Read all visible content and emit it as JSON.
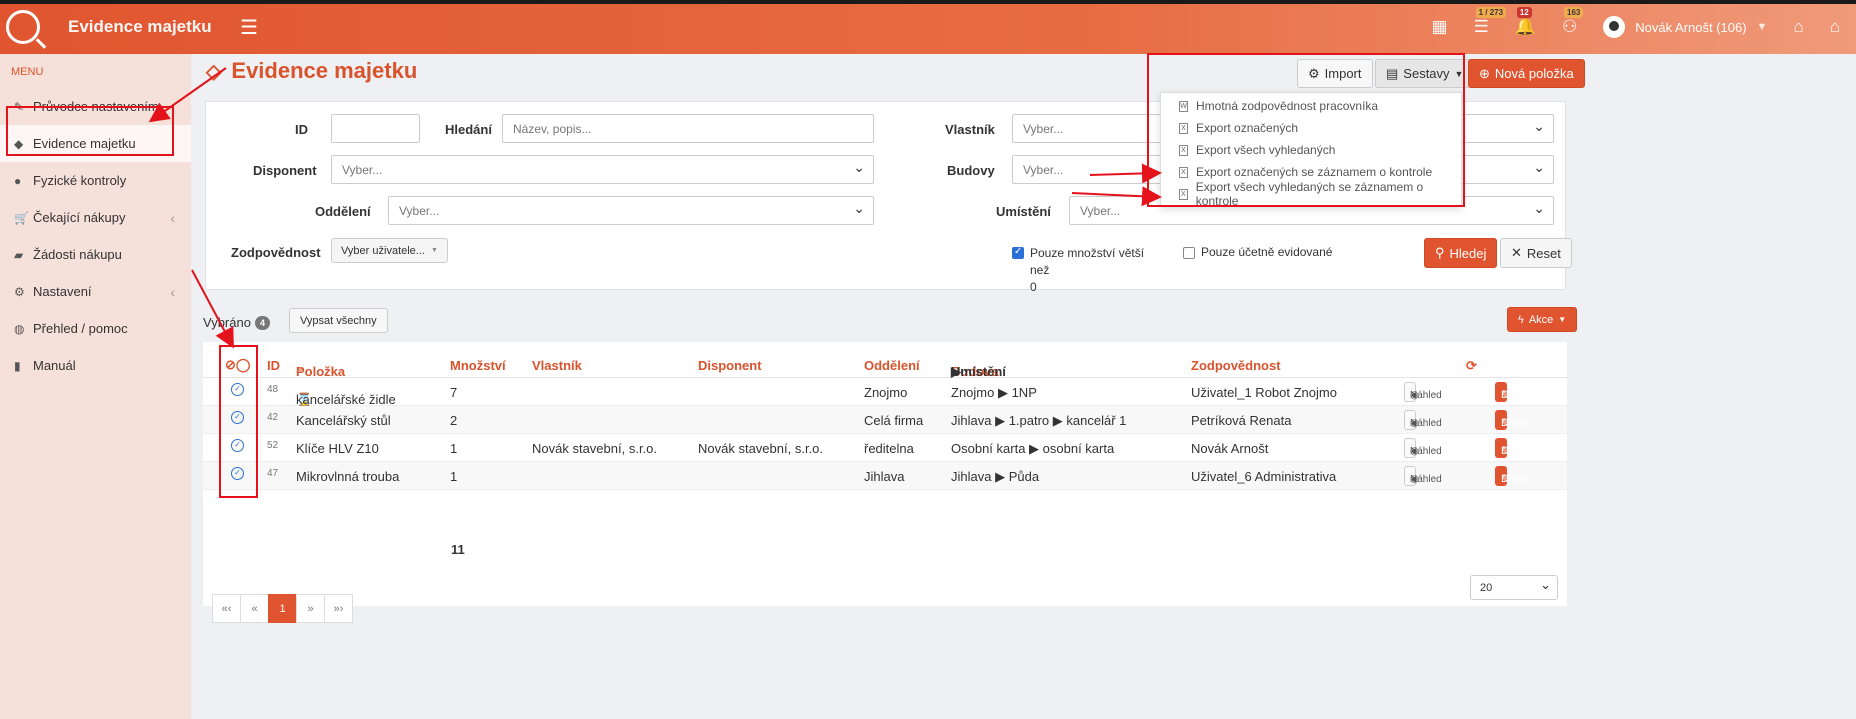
{
  "app": {
    "title": "Evidence majetku"
  },
  "topbar": {
    "badges": {
      "tasks": "1 / 273",
      "bell": "12",
      "group": "163"
    },
    "user": "Novák Arnošt (106)"
  },
  "sidebar": {
    "menu_label": "MENU",
    "items": [
      {
        "label": "Průvodce nastavením",
        "icon": "pencil-icon"
      },
      {
        "label": "Evidence majetku",
        "icon": "diamond-icon"
      },
      {
        "label": "Fyzické kontroly",
        "icon": "check-circle-icon"
      },
      {
        "label": "Čekající nákupy",
        "icon": "cart-icon"
      },
      {
        "label": "Žádosti nákupu",
        "icon": "edit-icon"
      },
      {
        "label": "Nastavení",
        "icon": "gears-icon"
      },
      {
        "label": "Přehled / pomoc",
        "icon": "globe-icon"
      },
      {
        "label": "Manuál",
        "icon": "book-icon"
      }
    ]
  },
  "page": {
    "title": "Evidence majetku",
    "import_label": "Import",
    "sestavy_label": "Sestavy",
    "nova_label": "Nová položka"
  },
  "dropdown": {
    "items": [
      "Hmotná zodpovědnost pracovníka",
      "Export označených",
      "Export všech vyhledaných",
      "Export označených se záznamem o kontrole",
      "Export všech vyhledaných se záznamem o kontrole"
    ]
  },
  "filters": {
    "id_label": "ID",
    "search_label": "Hledání",
    "search_placeholder": "Název, popis...",
    "owner_label": "Vlastník",
    "owner_value": "Vyber...",
    "disponent_label": "Disponent",
    "disponent_value": "Vyber...",
    "buildings_label": "Budovy",
    "buildings_value": "Vyber...",
    "dept_label": "Oddělení",
    "dept_value": "Vyber...",
    "location_label": "Umístění",
    "location_value": "Vyber...",
    "resp_label": "Zodpovědnost",
    "resp_value": "Vyber uživatele...",
    "qty_check": "Pouze množství větší než",
    "qty_value": "0",
    "acct_check": "Pouze účetně evidované",
    "search_btn": "Hledej",
    "reset_btn": "Reset"
  },
  "results": {
    "selected_label": "Vybráno",
    "selected_count": "4",
    "list_all_btn": "Vypsat všechny",
    "actions_btn": "Akce",
    "columns": {
      "id": "ID",
      "item": "Položka",
      "qty": "Množství",
      "owner": "Vlastník",
      "disponent": "Disponent",
      "dept": "Oddělení",
      "building": "Budova",
      "arrow": "▶",
      "location": "Umístění",
      "resp": "Zodpovědnost"
    },
    "rows": [
      {
        "id": "48",
        "item": "kancelářské židle",
        "qty": "7",
        "owner": "",
        "disponent": "",
        "dept": "Znojmo",
        "location": "Znojmo ▶ 1NP",
        "resp": "Uživatel_1 Robot Znojmo"
      },
      {
        "id": "42",
        "item": "Kancelářský stůl",
        "qty": "2",
        "owner": "",
        "disponent": "",
        "dept": "Celá firma",
        "location": "Jihlava ▶ 1.patro ▶ kancelář 1",
        "resp": "Petríková Renata"
      },
      {
        "id": "52",
        "item": "Klíče HLV Z10",
        "qty": "1",
        "owner": "Novák stavební, s.r.o.",
        "disponent": "Novák stavební, s.r.o.",
        "dept": "ředitelna",
        "location": "Osobní karta ▶ osobní karta",
        "resp": "Novák Arnošt"
      },
      {
        "id": "47",
        "item": "Mikrovlnná trouba",
        "qty": "1",
        "owner": "",
        "disponent": "",
        "dept": "Jihlava",
        "location": "Jihlava ▶ Půda",
        "resp": "Uživatel_6 Administrativa"
      }
    ],
    "preview_btn": "Náhled",
    "detail_btn": "Detail",
    "qty_total": "11",
    "pager": [
      "«‹",
      "«",
      "1",
      "»",
      "»›"
    ],
    "per_page": "20"
  },
  "colors": {
    "accent": "#e0552f",
    "annotation": "#e4121b"
  }
}
